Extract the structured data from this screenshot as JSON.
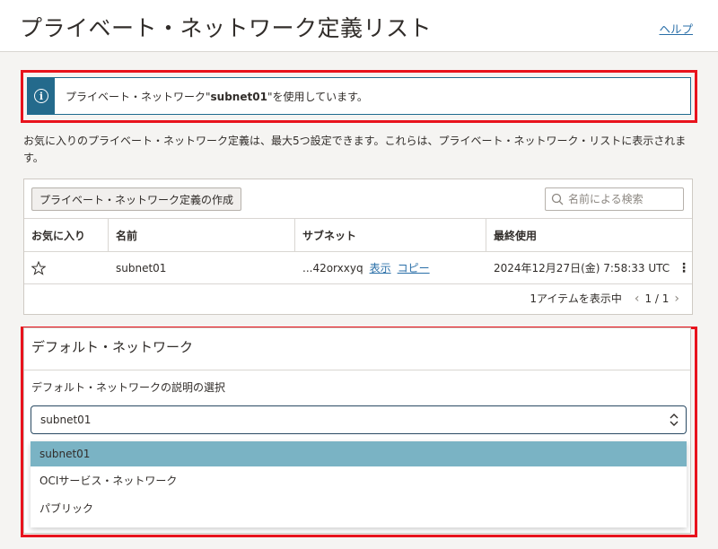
{
  "header": {
    "title": "プライベート・ネットワーク定義リスト",
    "help_label": "ヘルプ"
  },
  "info_banner": {
    "prefix": "プライベート・ネットワーク\"",
    "subnet": "subnet01",
    "suffix": "\"を使用しています。",
    "icon": "info-icon"
  },
  "description": "お気に入りのプライベート・ネットワーク定義は、最大5つ設定できます。これらは、プライベート・ネットワーク・リストに表示されます。",
  "toolbar": {
    "create_label": "プライベート・ネットワーク定義の作成",
    "search_placeholder": "名前による検索"
  },
  "table": {
    "columns": [
      "お気に入り",
      "名前",
      "サブネット",
      "最終使用"
    ],
    "rows": [
      {
        "favorite_icon": "star-outline-icon",
        "name": "subnet01",
        "subnet": "...42orxxyq",
        "show_label": "表示",
        "copy_label": "コピー",
        "last_used": "2024年12月27日(金) 7:58:33 UTC"
      }
    ]
  },
  "pager": {
    "items_text": "1アイテムを表示中",
    "page_text": "1 / 1"
  },
  "default_network": {
    "title": "デフォルト・ネットワーク",
    "field_label": "デフォルト・ネットワークの説明の選択",
    "selected_value": "subnet01",
    "options": [
      "subnet01",
      "OCIサービス・ネットワーク",
      "パブリック"
    ]
  },
  "colors": {
    "highlight_border": "#e8131d",
    "info_accent": "#246a8c",
    "selected_option": "#7ab3c4",
    "link": "#2a6fa8"
  }
}
